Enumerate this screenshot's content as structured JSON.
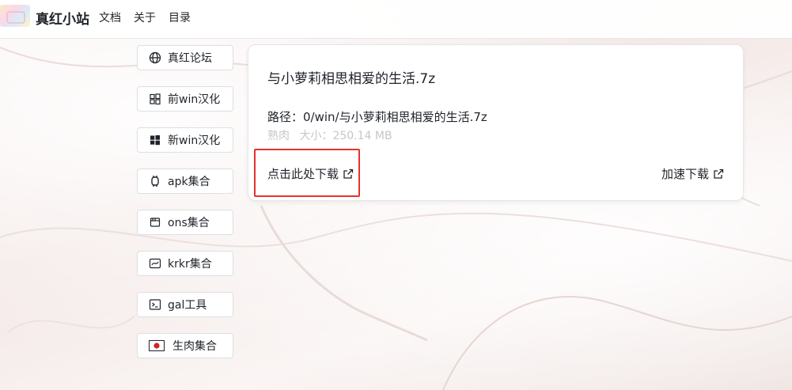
{
  "header": {
    "site_title": "真红小站",
    "nav": [
      "文档",
      "关于",
      "目录"
    ]
  },
  "sidebar": {
    "items": [
      {
        "label": "真红论坛",
        "icon": "globe-icon"
      },
      {
        "label": "前win汉化",
        "icon": "windows-outline-icon"
      },
      {
        "label": "新win汉化",
        "icon": "windows-icon"
      },
      {
        "label": "apk集合",
        "icon": "android-icon"
      },
      {
        "label": "ons集合",
        "icon": "ons-icon"
      },
      {
        "label": "krkr集合",
        "icon": "krkr-icon"
      },
      {
        "label": "gal工具",
        "icon": "terminal-icon"
      },
      {
        "label": "生肉集合",
        "icon": "japan-flag-icon"
      }
    ]
  },
  "file": {
    "title": "与小萝莉相思相爱的生活.7z",
    "path": "路径：0/win/与小萝莉相思相爱的生活.7z",
    "tag": "熟肉",
    "size": "大小：250.14 MB",
    "download_label": "点击此处下载",
    "fast_download_label": "加速下载"
  },
  "colors": {
    "highlight": "#e5322d",
    "muted_text": "#c5c7ca",
    "text": "#1f2329"
  }
}
